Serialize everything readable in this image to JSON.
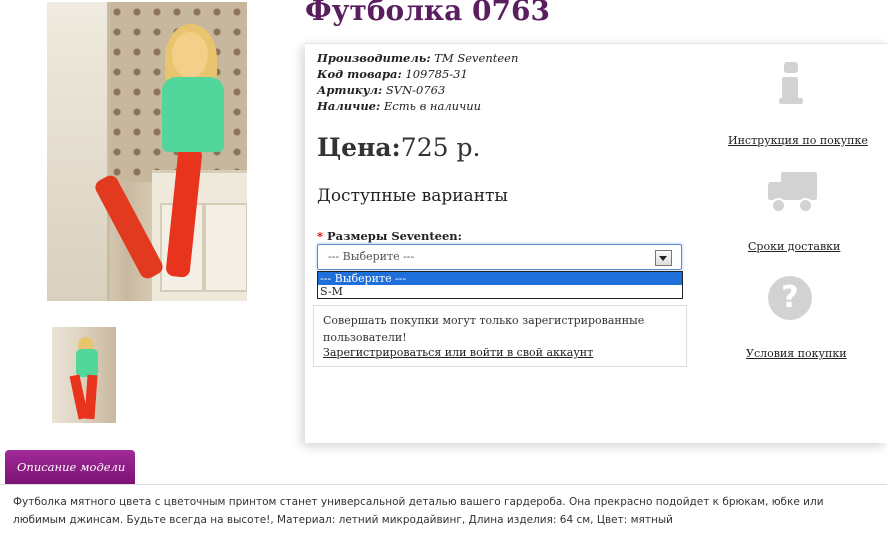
{
  "product": {
    "title": "Футболка 0763",
    "meta": {
      "manufacturer_label": "Производитель:",
      "manufacturer_value": "TM Seventeen",
      "code_label": "Код товара:",
      "code_value": "109785-31",
      "article_label": "Артикул:",
      "article_value": "SVN-0763",
      "stock_label": "Наличие:",
      "stock_value": "Есть в наличии"
    },
    "price_label": "Цена:",
    "price_value": "725 р."
  },
  "options": {
    "heading": "Доступные варианты",
    "required_mark": "*",
    "size_label": "Размеры Seventeen:",
    "select_value": "--- Выберите ---",
    "dropdown_options": [
      "--- Выберите ---",
      "S-M"
    ]
  },
  "notice": {
    "text": "Совершать покупки могут только зарегистрированные пользователи!",
    "link": "Зарегистрироваться или войти в свой аккаунт"
  },
  "side_links": {
    "instruction": "Инструкция по покупке",
    "delivery": "Сроки доставки",
    "terms": "Условия покупки"
  },
  "description": {
    "tab_label": "Описание модели",
    "text": "Футболка мятного цвета с цветочным принтом станет универсальной деталью вашего гардероба. Она прекрасно подойдет к брюкам, юбке или любимым джинсам. Будьте всегда на высоте!, Материал: летний микродайвинг, Длина изделия: 64 см, Цвет: мятный"
  },
  "colors": {
    "title": "#5a1e5e",
    "tab": "#8e1b86",
    "select_highlight": "#1e6fd9",
    "icon_gray": "#d2d2d2"
  }
}
